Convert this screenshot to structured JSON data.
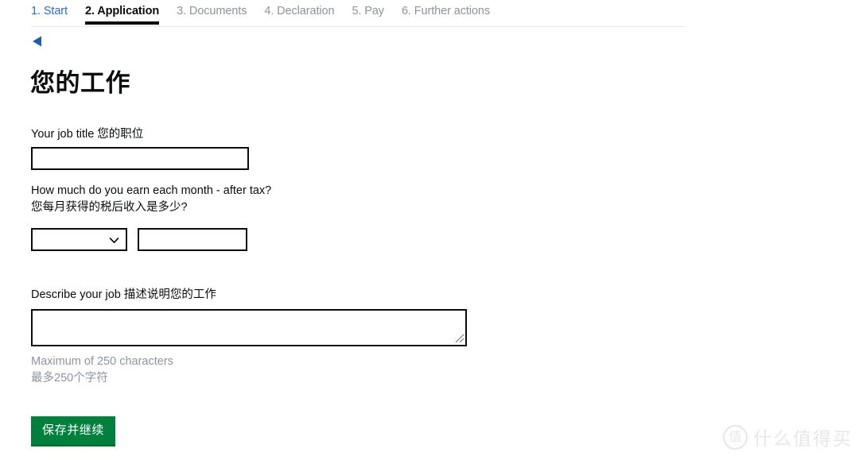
{
  "step_nav": {
    "steps": [
      {
        "label": "1. Start",
        "state": "done"
      },
      {
        "label": "2. Application",
        "state": "current"
      },
      {
        "label": "3. Documents",
        "state": "muted"
      },
      {
        "label": "4. Declaration",
        "state": "muted"
      },
      {
        "label": "5. Pay",
        "state": "muted"
      },
      {
        "label": "6. Further actions",
        "state": "muted"
      }
    ]
  },
  "back": {
    "icon": "back-triangle-icon",
    "color": "#1e60a8"
  },
  "page": {
    "title": "您的工作"
  },
  "form": {
    "job_title": {
      "label": "Your job title 您的职位",
      "value": "",
      "placeholder": ""
    },
    "earnings": {
      "label": "How much do you earn each month - after tax?\n您每月获得的税后收入是多少?",
      "currency_select": {
        "value": "",
        "options": [
          ""
        ],
        "icon": "chevron-down-icon"
      },
      "amount": {
        "value": "",
        "placeholder": ""
      }
    },
    "describe_job": {
      "label": "Describe your job 描述说明您的工作",
      "value": "",
      "placeholder": "",
      "hint": "Maximum of 250 characters\n最多250个字符",
      "resize_icon": "resize-grip-icon"
    }
  },
  "submit": {
    "label": "保存并继续",
    "color": "#00803c"
  },
  "watermark": {
    "badge": "值",
    "text": "什么值得买",
    "color": "#e6e7e8"
  }
}
